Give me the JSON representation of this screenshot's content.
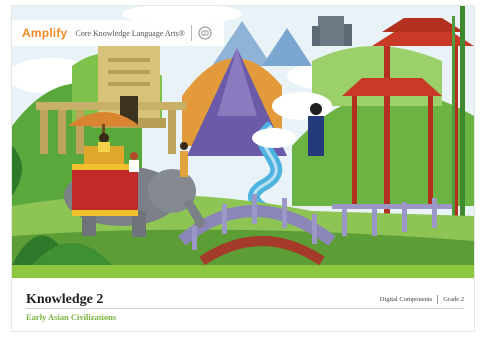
{
  "header": {
    "brand": "Amplify",
    "product": "Core Knowledge Language Arts®",
    "seal_icon": "ckla-seal-icon"
  },
  "cover": {
    "title": "Knowledge 2",
    "subtitle": "Early Asian Civilizations",
    "components_label": "Digital Components",
    "grade_label": "Grade 2"
  },
  "colors": {
    "brand_orange": "#f08a24",
    "band_green": "#8dc63f",
    "subtitle_green": "#7ab33a",
    "sky": "#e9f3f7",
    "pagoda_red": "#c83a26",
    "river_blue": "#4fb3e0"
  }
}
